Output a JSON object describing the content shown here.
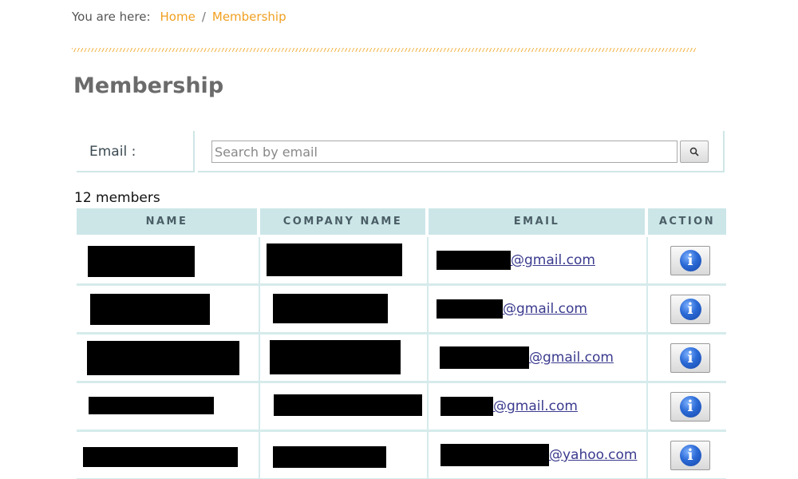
{
  "breadcrumb": {
    "label": "You are here:",
    "items": [
      {
        "text": "Home"
      },
      {
        "text": "Membership"
      }
    ],
    "separator": "/"
  },
  "page": {
    "title": "Membership"
  },
  "search": {
    "label": "Email :",
    "placeholder": "Search by email",
    "value": "",
    "button_icon": "search-icon"
  },
  "members": {
    "count_text": "12 members",
    "columns": [
      "NAME",
      "COMPANY NAME",
      "EMAIL",
      "ACTION"
    ],
    "rows": [
      {
        "email_domain": "@gmail.com",
        "action_icon": "info-icon"
      },
      {
        "email_domain": "@gmail.com",
        "action_icon": "info-icon"
      },
      {
        "email_domain": "@gmail.com",
        "action_icon": "info-icon"
      },
      {
        "email_domain": "@gmail.com",
        "action_icon": "info-icon"
      },
      {
        "email_domain": "@yahoo.com",
        "action_icon": "info-icon"
      }
    ]
  },
  "colors": {
    "accent": "#f0a020",
    "header_bg": "#cce6e8",
    "link": "#3b3b8f"
  }
}
